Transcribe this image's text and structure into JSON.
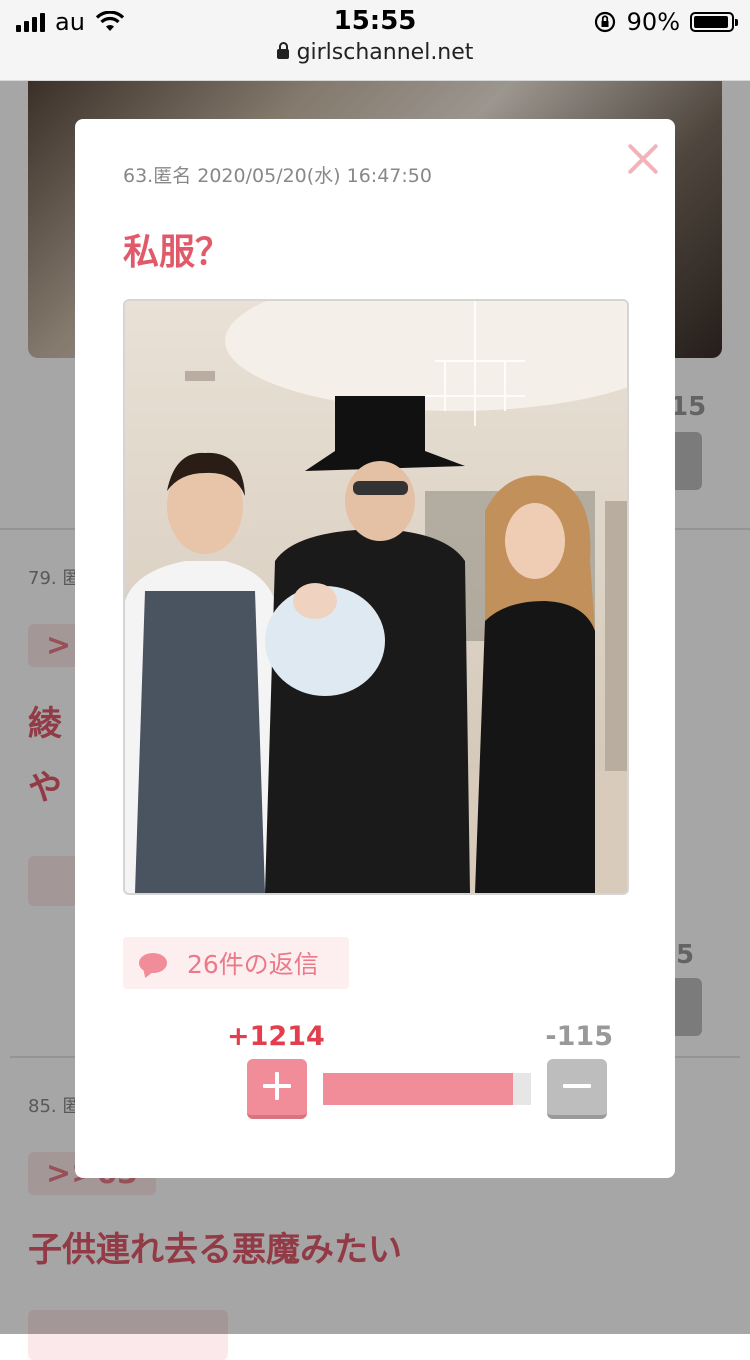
{
  "status_bar": {
    "carrier": "au",
    "time": "15:55",
    "battery": "90%",
    "url": "girlschannel.net"
  },
  "background": {
    "score_top": "15",
    "comment_79_meta": "79. 匿",
    "comment_79_anchor": ">",
    "comment_79_line1": "綾",
    "comment_79_line2": "や",
    "score_mid": "5",
    "comment_85_meta": "85. 匿",
    "comment_85_anchor": ">>63",
    "comment_85_text": "子供連れ去る悪魔みたい"
  },
  "modal": {
    "meta": "63.匿名 2020/05/20(水) 16:47:50",
    "title": "私服？",
    "reply_label": "26件の返信",
    "plus_score": "+1214",
    "minus_score": "-115",
    "vote_ratio": 0.913
  },
  "colors": {
    "accent_pink": "#e05a6a",
    "plus_red": "#e33e4e",
    "soft_pink": "#f08d99",
    "gray": "#bdbdbd"
  }
}
